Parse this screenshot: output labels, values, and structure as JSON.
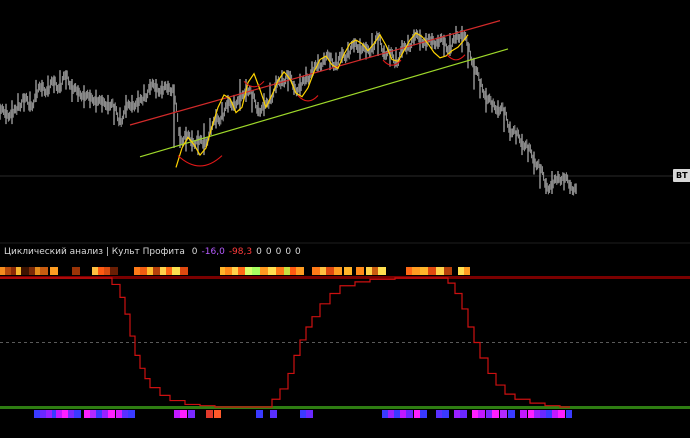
{
  "indicator": {
    "title": "Циклический анализ | Культ Профита",
    "values": [
      {
        "text": "0",
        "color": "#d9d9d9"
      },
      {
        "text": "-16,0",
        "color": "#b65cff"
      },
      {
        "text": "-98,3",
        "color": "#ff3b3b"
      },
      {
        "text": "0",
        "color": "#d9d9d9"
      },
      {
        "text": "0",
        "color": "#d9d9d9"
      },
      {
        "text": "0",
        "color": "#d9d9d9"
      },
      {
        "text": "0",
        "color": "#d9d9d9"
      },
      {
        "text": "0",
        "color": "#d9d9d9"
      }
    ]
  },
  "price_tag": "BT",
  "colors": {
    "background": "#000000",
    "price_bars": "#9a9a9a",
    "channel_upper": "#d12a2a",
    "channel_lower": "#9ed82a",
    "cycle_wave": "#ffd400",
    "cycle_marks": "#e01818",
    "oscillator_line": "#cc1010",
    "top_band": "#7a0000",
    "bottom_band": "#2e7d12"
  },
  "chart_data": {
    "type": "line",
    "title": "",
    "xlabel": "",
    "ylabel": "",
    "price_series": [
      [
        0,
        142
      ],
      [
        6,
        148
      ],
      [
        12,
        137
      ],
      [
        18,
        152
      ],
      [
        24,
        160
      ],
      [
        30,
        151
      ],
      [
        36,
        162
      ],
      [
        42,
        175
      ],
      [
        48,
        168
      ],
      [
        54,
        180
      ],
      [
        60,
        172
      ],
      [
        66,
        186
      ],
      [
        72,
        176
      ],
      [
        78,
        162
      ],
      [
        84,
        169
      ],
      [
        90,
        155
      ],
      [
        96,
        164
      ],
      [
        102,
        150
      ],
      [
        108,
        158
      ],
      [
        114,
        148
      ],
      [
        120,
        136
      ],
      [
        126,
        144
      ],
      [
        132,
        158
      ],
      [
        138,
        150
      ],
      [
        144,
        163
      ],
      [
        150,
        170
      ],
      [
        156,
        176
      ],
      [
        162,
        166
      ],
      [
        168,
        174
      ],
      [
        174,
        170
      ],
      [
        180,
        110
      ],
      [
        186,
        122
      ],
      [
        192,
        106
      ],
      [
        198,
        118
      ],
      [
        204,
        102
      ],
      [
        210,
        126
      ],
      [
        216,
        132
      ],
      [
        222,
        142
      ],
      [
        228,
        150
      ],
      [
        234,
        158
      ],
      [
        240,
        152
      ],
      [
        246,
        176
      ],
      [
        252,
        162
      ],
      [
        258,
        150
      ],
      [
        264,
        146
      ],
      [
        270,
        160
      ],
      [
        276,
        172
      ],
      [
        282,
        180
      ],
      [
        288,
        186
      ],
      [
        294,
        174
      ],
      [
        300,
        170
      ],
      [
        306,
        182
      ],
      [
        312,
        190
      ],
      [
        318,
        196
      ],
      [
        324,
        204
      ],
      [
        330,
        206
      ],
      [
        336,
        198
      ],
      [
        342,
        206
      ],
      [
        348,
        212
      ],
      [
        354,
        218
      ],
      [
        360,
        222
      ],
      [
        366,
        210
      ],
      [
        372,
        218
      ],
      [
        378,
        228
      ],
      [
        384,
        214
      ],
      [
        390,
        210
      ],
      [
        396,
        202
      ],
      [
        402,
        212
      ],
      [
        408,
        220
      ],
      [
        414,
        226
      ],
      [
        420,
        232
      ],
      [
        426,
        220
      ],
      [
        432,
        228
      ],
      [
        438,
        222
      ],
      [
        444,
        226
      ],
      [
        450,
        214
      ],
      [
        456,
        228
      ],
      [
        462,
        236
      ],
      [
        468,
        218
      ],
      [
        474,
        200
      ],
      [
        480,
        176
      ],
      [
        486,
        166
      ],
      [
        492,
        150
      ],
      [
        498,
        152
      ],
      [
        504,
        144
      ],
      [
        510,
        128
      ],
      [
        516,
        118
      ],
      [
        522,
        114
      ],
      [
        528,
        102
      ],
      [
        534,
        94
      ],
      [
        540,
        80
      ],
      [
        546,
        64
      ],
      [
        552,
        58
      ],
      [
        558,
        72
      ],
      [
        564,
        70
      ],
      [
        570,
        62
      ],
      [
        576,
        58
      ]
    ],
    "channel": {
      "upper": [
        [
          130,
          130
        ],
        [
          500,
          248
        ]
      ],
      "lower": [
        [
          140,
          94
        ],
        [
          508,
          216
        ]
      ]
    },
    "cycle_wave": [
      [
        176,
        82
      ],
      [
        182,
        104
      ],
      [
        188,
        116
      ],
      [
        194,
        108
      ],
      [
        200,
        96
      ],
      [
        206,
        104
      ],
      [
        212,
        128
      ],
      [
        218,
        150
      ],
      [
        224,
        164
      ],
      [
        230,
        160
      ],
      [
        236,
        144
      ],
      [
        242,
        150
      ],
      [
        248,
        178
      ],
      [
        254,
        188
      ],
      [
        260,
        170
      ],
      [
        266,
        150
      ],
      [
        272,
        164
      ],
      [
        278,
        180
      ],
      [
        284,
        190
      ],
      [
        290,
        182
      ],
      [
        296,
        166
      ],
      [
        302,
        162
      ],
      [
        308,
        172
      ],
      [
        314,
        190
      ],
      [
        320,
        204
      ],
      [
        326,
        208
      ],
      [
        332,
        198
      ],
      [
        338,
        194
      ],
      [
        344,
        210
      ],
      [
        350,
        222
      ],
      [
        356,
        226
      ],
      [
        362,
        222
      ],
      [
        368,
        214
      ],
      [
        374,
        222
      ],
      [
        380,
        232
      ],
      [
        386,
        220
      ],
      [
        392,
        204
      ],
      [
        398,
        202
      ],
      [
        404,
        214
      ],
      [
        410,
        226
      ],
      [
        416,
        234
      ],
      [
        422,
        230
      ],
      [
        428,
        222
      ],
      [
        434,
        212
      ],
      [
        440,
        206
      ],
      [
        446,
        208
      ],
      [
        452,
        214
      ],
      [
        458,
        218
      ],
      [
        464,
        226
      ],
      [
        468,
        232
      ]
    ],
    "oscillator": {
      "ylim": [
        0,
        100
      ],
      "midline": 50,
      "values": [
        [
          0,
          100
        ],
        [
          100,
          100
        ],
        [
          112,
          95
        ],
        [
          120,
          85
        ],
        [
          125,
          72
        ],
        [
          130,
          55
        ],
        [
          135,
          40
        ],
        [
          140,
          30
        ],
        [
          145,
          22
        ],
        [
          150,
          15
        ],
        [
          160,
          9
        ],
        [
          170,
          5
        ],
        [
          185,
          2
        ],
        [
          200,
          1
        ],
        [
          215,
          0
        ],
        [
          260,
          0
        ],
        [
          272,
          6
        ],
        [
          280,
          14
        ],
        [
          288,
          26
        ],
        [
          294,
          40
        ],
        [
          300,
          52
        ],
        [
          306,
          62
        ],
        [
          312,
          70
        ],
        [
          320,
          80
        ],
        [
          330,
          88
        ],
        [
          340,
          94
        ],
        [
          355,
          97
        ],
        [
          370,
          99
        ],
        [
          395,
          100
        ],
        [
          440,
          100
        ],
        [
          448,
          96
        ],
        [
          455,
          88
        ],
        [
          462,
          76
        ],
        [
          468,
          62
        ],
        [
          474,
          50
        ],
        [
          480,
          38
        ],
        [
          488,
          26
        ],
        [
          496,
          17
        ],
        [
          505,
          10
        ],
        [
          515,
          6
        ],
        [
          530,
          3
        ],
        [
          545,
          1
        ],
        [
          560,
          0
        ],
        [
          570,
          0
        ]
      ]
    },
    "heat_strip_top": [
      [
        0,
        "#f58c1e"
      ],
      [
        5,
        "#b64a0c"
      ],
      [
        11,
        "#8c2a06"
      ],
      [
        16,
        "#f7b52d"
      ],
      [
        21,
        "#3d1300"
      ],
      [
        29,
        "#7b2a07"
      ],
      [
        35,
        "#e38c1c"
      ],
      [
        40,
        "#c85c10"
      ],
      [
        50,
        "#ff9d22"
      ],
      [
        72,
        "#9a3407"
      ],
      [
        92,
        "#ffc040"
      ],
      [
        98,
        "#ff5a12"
      ],
      [
        104,
        "#d94c10"
      ],
      [
        110,
        "#6a1e04"
      ],
      [
        134,
        "#ff7a18"
      ],
      [
        140,
        "#f05d12"
      ],
      [
        147,
        "#ffbe2e"
      ],
      [
        153,
        "#b5400a"
      ],
      [
        160,
        "#ffd24a"
      ],
      [
        166,
        "#ff6814"
      ],
      [
        172,
        "#fbe04f"
      ],
      [
        180,
        "#e04a10"
      ],
      [
        220,
        "#ffb52a"
      ],
      [
        225,
        "#ff8a1a"
      ],
      [
        232,
        "#ffd24a"
      ],
      [
        238,
        "#ff6a16"
      ],
      [
        245,
        "#d9ff6a"
      ],
      [
        252,
        "#a8ff60"
      ],
      [
        260,
        "#ff9a20"
      ],
      [
        268,
        "#ffe050"
      ],
      [
        276,
        "#ff7a18"
      ],
      [
        284,
        "#c8e040"
      ],
      [
        290,
        "#ff5a12"
      ],
      [
        296,
        "#ff9d22"
      ],
      [
        312,
        "#ff7a18"
      ],
      [
        320,
        "#ffc040"
      ],
      [
        326,
        "#e04a10"
      ],
      [
        334,
        "#ff9d22"
      ],
      [
        344,
        "#ffb52a"
      ],
      [
        356,
        "#ff8a1a"
      ],
      [
        366,
        "#ffd24a"
      ],
      [
        372,
        "#c85c10"
      ],
      [
        378,
        "#ffe050"
      ],
      [
        406,
        "#ff6a16"
      ],
      [
        412,
        "#ff9d22"
      ],
      [
        420,
        "#ffb52a"
      ],
      [
        428,
        "#e04a10"
      ],
      [
        436,
        "#ffd24a"
      ],
      [
        444,
        "#b5400a"
      ],
      [
        458,
        "#ffe050"
      ],
      [
        464,
        "#ff9d22"
      ]
    ],
    "heat_strip_bottom": [
      [
        34,
        "#3a3aff"
      ],
      [
        40,
        "#6a28ff"
      ],
      [
        46,
        "#9a20ff"
      ],
      [
        52,
        "#3a3aff"
      ],
      [
        56,
        "#c218ff"
      ],
      [
        62,
        "#ff20ff"
      ],
      [
        68,
        "#7a28ff"
      ],
      [
        74,
        "#3a3aff"
      ],
      [
        84,
        "#ff20ff"
      ],
      [
        90,
        "#b22aff"
      ],
      [
        96,
        "#3a3aff"
      ],
      [
        102,
        "#9a20ff"
      ],
      [
        108,
        "#ff20ff"
      ],
      [
        116,
        "#d81cff"
      ],
      [
        122,
        "#5a30ff"
      ],
      [
        128,
        "#3a3aff"
      ],
      [
        174,
        "#c218ff"
      ],
      [
        180,
        "#ff20ff"
      ],
      [
        188,
        "#7a28ff"
      ],
      [
        206,
        "#e0392b"
      ],
      [
        214,
        "#ff5a2a"
      ],
      [
        256,
        "#3a3aff"
      ],
      [
        270,
        "#5a30ff"
      ],
      [
        300,
        "#3a3aff"
      ],
      [
        306,
        "#6a28ff"
      ],
      [
        382,
        "#3a3aff"
      ],
      [
        388,
        "#9a20ff"
      ],
      [
        394,
        "#3a3aff"
      ],
      [
        400,
        "#c218ff"
      ],
      [
        406,
        "#6a28ff"
      ],
      [
        414,
        "#ff20ff"
      ],
      [
        420,
        "#3a3aff"
      ],
      [
        436,
        "#5a30ff"
      ],
      [
        442,
        "#3a3aff"
      ],
      [
        454,
        "#9a20ff"
      ],
      [
        460,
        "#6a28ff"
      ],
      [
        472,
        "#ff20ff"
      ],
      [
        478,
        "#c218ff"
      ],
      [
        486,
        "#7a28ff"
      ],
      [
        492,
        "#ff20ff"
      ],
      [
        500,
        "#b22aff"
      ],
      [
        508,
        "#3a3aff"
      ],
      [
        520,
        "#c218ff"
      ],
      [
        528,
        "#ff20ff"
      ],
      [
        534,
        "#9a20ff"
      ],
      [
        540,
        "#6a28ff"
      ],
      [
        546,
        "#3a3aff"
      ],
      [
        552,
        "#c218ff"
      ],
      [
        558,
        "#ff20ff"
      ],
      [
        566,
        "#3a3aff"
      ]
    ]
  }
}
